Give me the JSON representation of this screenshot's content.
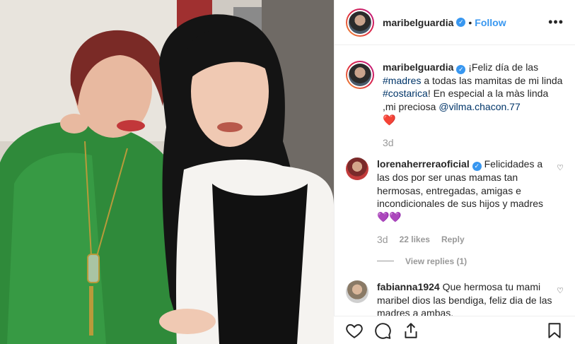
{
  "post": {
    "username": "maribelguardia",
    "follow_label": "Follow",
    "more_label": "•••",
    "dot": "•"
  },
  "caption": {
    "username": "maribelguardia",
    "text_1": " ¡Feliz día de las ",
    "tag_madres": "#madres",
    "text_2": " a todas las mamitas de mi linda ",
    "tag_costarica": "#costarica",
    "text_3": "! En especial a la màs linda ,mi preciosa ",
    "mention": "@vilma.chacon.77",
    "heart": "❤️",
    "time": "3d"
  },
  "comments": [
    {
      "username": "lorenaherreraoficial",
      "text": " Felicidades a las dos por ser unas mamas tan hermosas, entregadas, amigas e incondicionales de sus hijos y madres ",
      "emoji": "💜💜",
      "time": "3d",
      "likes": "22 likes",
      "reply": "Reply",
      "view_replies": "View replies (1)"
    },
    {
      "username": "fabianna1924",
      "text": " Que hermosa tu mami maribel dios las bendiga, feliz dia de las madres a ambas,"
    }
  ],
  "icons": {
    "heart": "heart-icon",
    "comment": "comment-icon",
    "share": "share-icon",
    "bookmark": "bookmark-icon",
    "verified": "verified-badge-icon"
  },
  "colors": {
    "link": "#3897f0",
    "hashtag": "#003569",
    "meta": "#999999"
  }
}
